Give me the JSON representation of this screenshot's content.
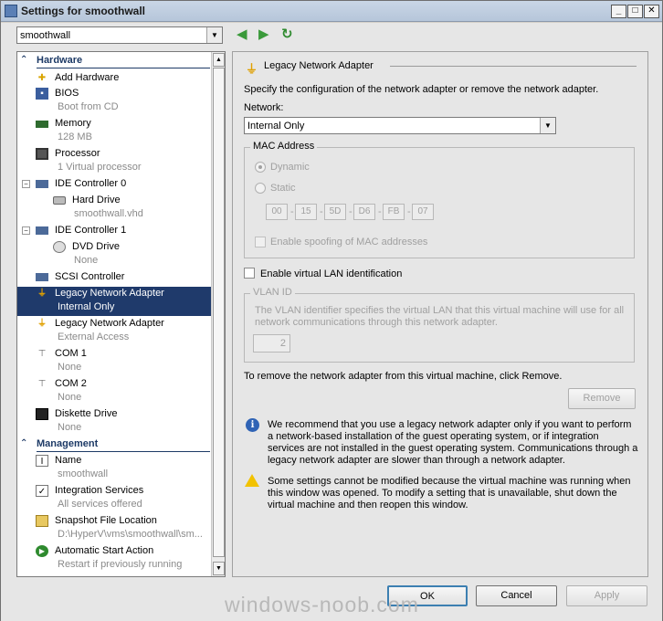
{
  "window": {
    "title": "Settings for smoothwall"
  },
  "vm_select": {
    "value": "smoothwall"
  },
  "nav": {
    "back": "◀",
    "forward": "▶",
    "refresh": "↻"
  },
  "sections": {
    "hardware": "Hardware",
    "management": "Management"
  },
  "hardware_items": [
    {
      "title": "Add Hardware"
    },
    {
      "title": "BIOS",
      "sub": "Boot from CD"
    },
    {
      "title": "Memory",
      "sub": "128 MB"
    },
    {
      "title": "Processor",
      "sub": "1 Virtual processor"
    },
    {
      "title": "IDE Controller 0"
    },
    {
      "title": "Hard Drive",
      "sub": "smoothwall.vhd"
    },
    {
      "title": "IDE Controller 1"
    },
    {
      "title": "DVD Drive",
      "sub": "None"
    },
    {
      "title": "SCSI Controller"
    },
    {
      "title": "Legacy Network Adapter",
      "sub": "Internal Only"
    },
    {
      "title": "Legacy Network Adapter",
      "sub": "External Access"
    },
    {
      "title": "COM 1",
      "sub": "None"
    },
    {
      "title": "COM 2",
      "sub": "None"
    },
    {
      "title": "Diskette Drive",
      "sub": "None"
    }
  ],
  "management_items": [
    {
      "title": "Name",
      "sub": "smoothwall"
    },
    {
      "title": "Integration Services",
      "sub": "All services offered"
    },
    {
      "title": "Snapshot File Location",
      "sub": "D:\\HyperV\\vms\\smoothwall\\sm..."
    },
    {
      "title": "Automatic Start Action",
      "sub": "Restart if previously running"
    }
  ],
  "panel": {
    "header": "Legacy Network Adapter",
    "desc": "Specify the configuration of the network adapter or remove the network adapter.",
    "network_label": "Network:",
    "network_value": "Internal Only",
    "mac_group": "MAC Address",
    "dynamic": "Dynamic",
    "static": "Static",
    "mac": [
      "00",
      "15",
      "5D",
      "D6",
      "FB",
      "07"
    ],
    "spoof": "Enable spoofing of MAC addresses",
    "vlan_check": "Enable virtual LAN identification",
    "vlan_group": "VLAN ID",
    "vlan_desc1": "The VLAN identifier specifies the virtual LAN that this virtual machine will use for all",
    "vlan_desc2": "network communications through this network adapter.",
    "vlan_value": "2",
    "remove_text": "To remove the network adapter from this virtual machine, click Remove.",
    "remove": "Remove",
    "info_lines": [
      "We recommend that you use a legacy network adapter only if you want to perform",
      "a network-based installation of the guest operating system, or if integration",
      "services are not installed in the guest operating system. Communications through a",
      "legacy network adapter are slower than through a network adapter."
    ],
    "warn_lines": [
      "Some settings cannot be modified because the virtual machine was running when",
      "this window was opened. To modify a setting that is unavailable, shut down the",
      "virtual machine and then reopen this window."
    ]
  },
  "buttons": {
    "ok": "OK",
    "cancel": "Cancel",
    "apply": "Apply"
  },
  "watermark": "windows-noob.com",
  "colors": {
    "selection": "#1f3a6b",
    "section": "#1d3a66",
    "info": "#2f63b5",
    "warning": "#f2c200"
  }
}
